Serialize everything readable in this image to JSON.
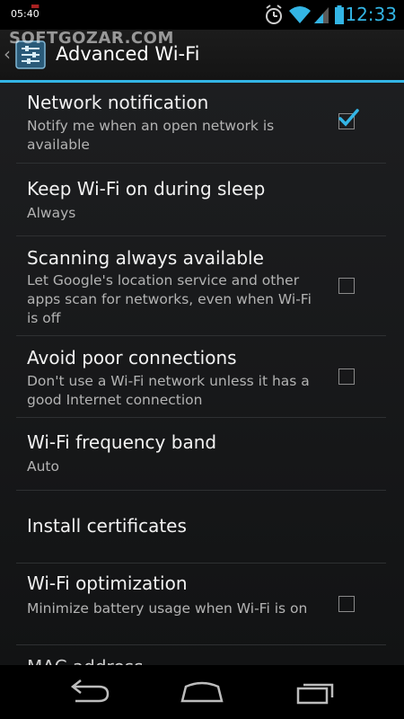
{
  "status_bar": {
    "clock_left": "05:40",
    "time": "12:33",
    "icons": [
      "alarm-icon",
      "wifi-icon",
      "signal-icon",
      "battery-icon"
    ]
  },
  "action_bar": {
    "title": "Advanced Wi-Fi",
    "watermark": "SOFTGOZAR.COM",
    "accent_color": "#33b5e5"
  },
  "settings": {
    "network_notification": {
      "title": "Network notification",
      "subtitle": "Notify me when an open network is available",
      "checked": true
    },
    "keep_wifi_sleep": {
      "title": "Keep Wi-Fi on during sleep",
      "subtitle": "Always"
    },
    "scanning_always": {
      "title": "Scanning always available",
      "subtitle": "Let Google's location service and other apps scan for networks, even when Wi-Fi is off",
      "checked": false
    },
    "avoid_poor": {
      "title": "Avoid poor connections",
      "subtitle": "Don't use a Wi-Fi network unless it has a good Internet connection",
      "checked": false
    },
    "frequency_band": {
      "title": "Wi-Fi frequency band",
      "subtitle": "Auto"
    },
    "install_certificates": {
      "title": "Install certificates"
    },
    "wifi_optimization": {
      "title": "Wi-Fi optimization",
      "subtitle": "Minimize battery usage when Wi-Fi is on",
      "checked": false
    },
    "mac_address": {
      "title": "MAC address"
    }
  },
  "nav_bar": {
    "icons": [
      "back-icon",
      "home-icon",
      "recents-icon"
    ]
  }
}
